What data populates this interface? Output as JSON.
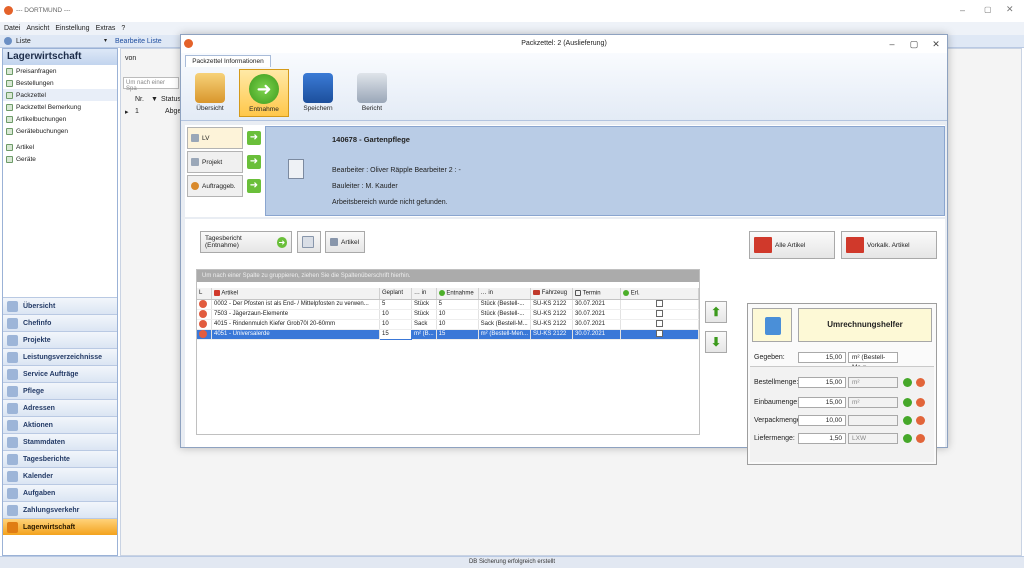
{
  "app": {
    "title": "--- DORTMUND ---",
    "menu": [
      "Datei",
      "Ansicht",
      "Einstellung",
      "Extras",
      "?"
    ],
    "toolbar": {
      "liste": "Liste",
      "bearbeite": "Bearbeite Liste",
      "von": "von"
    }
  },
  "sidebar": {
    "title": "Lagerwirtschaft",
    "items": [
      {
        "label": "Preisanfragen"
      },
      {
        "label": "Bestellungen"
      },
      {
        "label": "Packzettel"
      },
      {
        "label": "Packzettel Bemerkung"
      },
      {
        "label": "Artikelbuchungen"
      },
      {
        "label": "Gerätebuchungen"
      },
      {
        "label": "Artikel"
      },
      {
        "label": "Geräte"
      }
    ],
    "nav": [
      "Übersicht",
      "Chefinfo",
      "Projekte",
      "Leistungsverzeichnisse",
      "Service Aufträge",
      "Pflege",
      "Adressen",
      "Aktionen",
      "Stammdaten",
      "Tagesberichte",
      "Kalender",
      "Aufgaben",
      "Zahlungsverkehr",
      "Lagerwirtschaft"
    ]
  },
  "bglist": {
    "search": "Um nach einer Spa",
    "col_nr": "Nr.",
    "col_status": "Status",
    "row_nr": "1",
    "row_status": "Abge"
  },
  "status": "DB Sicherung erfolgreich erstellt",
  "dialog": {
    "title": "Packzettel: 2 (Auslieferung)",
    "tab": "Packzettel Informationen",
    "ribbon": [
      "Übersicht",
      "Entnahme",
      "Speichern",
      "Bericht"
    ],
    "side_buttons": [
      "LV",
      "Projekt",
      "Auftraggeb."
    ],
    "info": {
      "header": "140678 - Gartenpflege",
      "line1": "Bearbeiter : Oliver Räpple   Bearbeiter 2 :  -",
      "line2": "Bauleiter : M. Kauder",
      "line3": "Arbeitsbereich wurde nicht gefunden."
    },
    "actions": {
      "tagesbericht": "Tagesbericht (Entnahme)",
      "artikel": "Artikel",
      "alle": "Alle Artikel",
      "vorkalk": "Vorkalk. Artikel"
    },
    "grid": {
      "group_hint": "Um nach einer Spalte zu gruppieren, ziehen Sie die Spaltenüberschrift hierhin.",
      "columns": [
        "L",
        "Artikel",
        "Geplant",
        "in",
        "Entnahme",
        "in",
        "Fahrzeug",
        "Termin",
        "Erl."
      ],
      "rows": [
        [
          "0002 - Der Pfosten ist als End- / Mittelpfosten zu verwen...",
          "5",
          "Stück",
          "5",
          "Stück (Bestell-...",
          "SU-KS 2122",
          "30.07.2021"
        ],
        [
          "7503 - Jägerzaun-Elemente",
          "10",
          "Stück",
          "10",
          "Stück (Bestell-...",
          "SU-KS 2122",
          "30.07.2021"
        ],
        [
          "4015 - Rindenmulch Kiefer Grob70l 20-60mm",
          "10",
          "Sack",
          "10",
          "Sack (Bestell-M...",
          "SU-KS 2122",
          "30.07.2021"
        ],
        [
          "4051 - Universalerde",
          "15",
          "m² (B...",
          "15",
          "m² (Bestell-Men...",
          "SU-KS 2122",
          "30.07.2021"
        ]
      ]
    },
    "calc": {
      "title": "Umrechnungshelfer",
      "gegeben_label": "Gegeben:",
      "gegeben_value": "15,00",
      "gegeben_unit": "m² (Bestell-Me",
      "rows": [
        {
          "label": "Bestellmenge:",
          "value": "15,00",
          "unit": "m²"
        },
        {
          "label": "Einbaumenge:",
          "value": "15,00",
          "unit": "m²"
        },
        {
          "label": "Verpackmenge:",
          "value": "10,00",
          "unit": ""
        },
        {
          "label": "Liefermenge:",
          "value": "1,50",
          "unit": "LXW"
        }
      ]
    }
  }
}
